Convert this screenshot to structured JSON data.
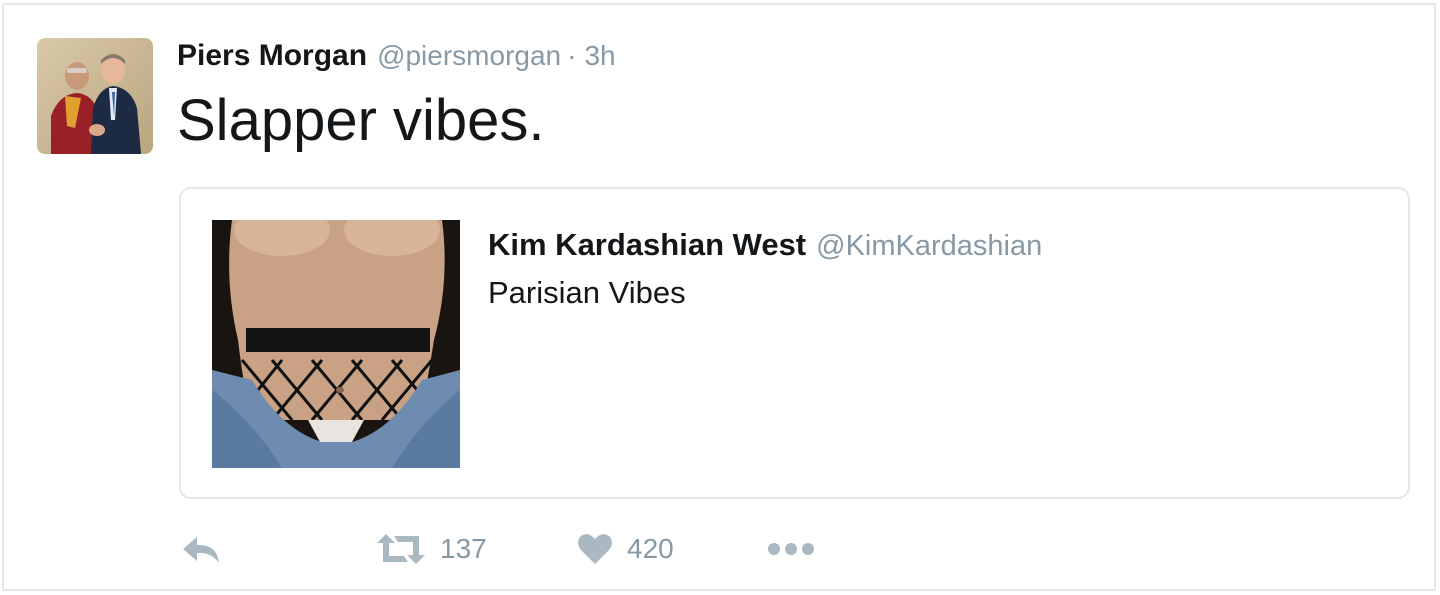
{
  "tweet": {
    "author_name": "Piers Morgan",
    "author_handle": "@piersmorgan",
    "separator": "·",
    "time": "3h",
    "text": "Slapper vibes."
  },
  "quoted": {
    "author_name": "Kim Kardashian West",
    "author_handle": "@KimKardashian",
    "text": "Parisian Vibes"
  },
  "actions": {
    "reply_icon": "reply-icon",
    "retweet_icon": "retweet-icon",
    "retweet_count": "137",
    "like_icon": "heart-icon",
    "like_count": "420",
    "more_icon": "more-dots-icon"
  },
  "colors": {
    "text": "#14171a",
    "muted": "#8899a6",
    "border": "#e1e8ed",
    "icon": "#aab8c2"
  }
}
